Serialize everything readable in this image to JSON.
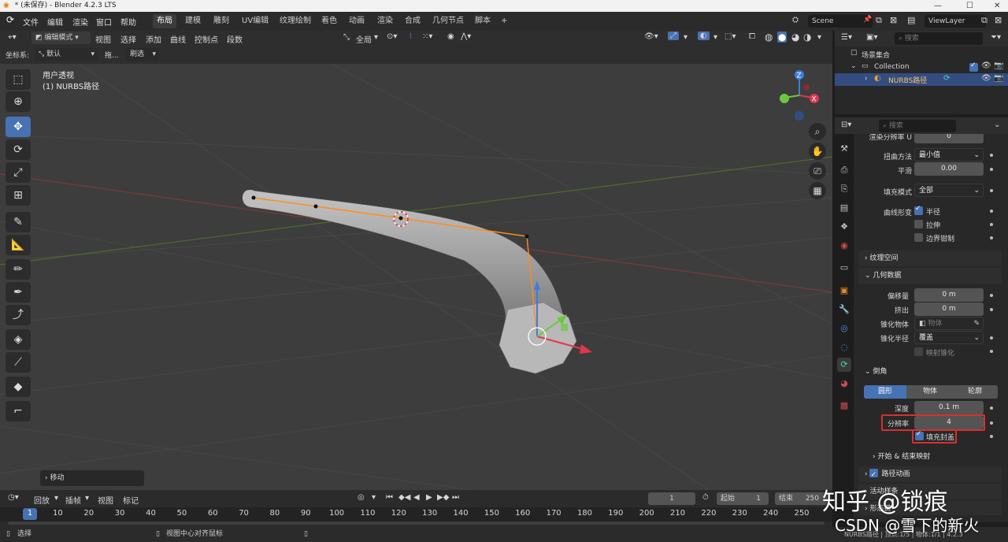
{
  "title": "* (未保存) - Blender 4.2.3 LTS",
  "main_menu": [
    "文件",
    "编辑",
    "渲染",
    "窗口",
    "帮助"
  ],
  "workspaces": [
    "布局",
    "建模",
    "雕刻",
    "UV编辑",
    "纹理绘制",
    "着色",
    "动画",
    "渲染",
    "合成",
    "几何节点",
    "脚本"
  ],
  "active_workspace": "布局",
  "scene": "Scene",
  "view_layer": "ViewLayer",
  "header": {
    "mode": "编辑模式",
    "menus": [
      "视图",
      "选择",
      "添加",
      "曲线",
      "控制点",
      "段数"
    ],
    "pivot": "全局",
    "coord_label": "坐标系:",
    "coord_value": "默认",
    "drag_label": "拖...",
    "select_label": "刷选"
  },
  "viewport": {
    "perspective": "用户透视",
    "object": "(1) NURBS路径",
    "last_op": "移动"
  },
  "outliner": {
    "search_placeholder": "搜索",
    "scene_collection": "场景集合",
    "collection": "Collection",
    "object": "NURBS路径"
  },
  "properties": {
    "search_placeholder": "搜索",
    "render_res_label": "渲染分辨率 U",
    "render_res_value": "0",
    "twist_label": "扭曲方法",
    "twist_value": "最小值",
    "smooth_label": "平滑",
    "smooth_value": "0.00",
    "fill_label": "填充模式",
    "fill_value": "全部",
    "deform_label": "曲线形变",
    "deform_radius": "半径",
    "deform_stretch": "拉伸",
    "deform_bounds": "边界钳制",
    "texture_space": "纹理空间",
    "geometry": "几何数据",
    "offset_label": "偏移量",
    "offset_value": "0 m",
    "extrude_label": "挤出",
    "extrude_value": "0 m",
    "taper_obj_label": "锥化物体",
    "taper_obj_placeholder": "物体",
    "taper_radius_label": "锥化半径",
    "taper_radius_value": "覆盖",
    "map_taper": "映射锥化",
    "bevel": "倒角",
    "bevel_tabs": [
      "圆形",
      "物体",
      "轮廓"
    ],
    "depth_label": "深度",
    "depth_value": "0.1 m",
    "resolution_label": "分辨率",
    "resolution_value": "4",
    "fill_caps": "填充封盖",
    "start_end": "开始 & 结束映射",
    "path_anim": "路径动画",
    "active_spline": "活动样条",
    "shape_keys": "形态键"
  },
  "timeline": {
    "menus": [
      "回放",
      "插帧",
      "视图",
      "标记"
    ],
    "current_frame": "1",
    "start_label": "起始",
    "start_value": "1",
    "end_label": "结束",
    "end_value": "250",
    "ticks": [
      "1",
      "10",
      "20",
      "30",
      "40",
      "50",
      "60",
      "70",
      "80",
      "90",
      "100",
      "110",
      "120",
      "130",
      "140",
      "150",
      "160",
      "170",
      "180",
      "190",
      "200",
      "210",
      "220",
      "230",
      "240",
      "250"
    ]
  },
  "status": {
    "select": "选择",
    "center_view": "视图中心对齐鼠标",
    "right_info": "NURBS路径 | 顶点:1/5 | 物体:1/1 | 4.2.3"
  },
  "watermark": {
    "zhihu": "知乎 @锁痕",
    "csdn": "CSDN @雪下的新火"
  },
  "colors": {
    "accent": "#4772b3",
    "highlight_box": "#d9302c",
    "path_orange": "#ff8c1a"
  }
}
